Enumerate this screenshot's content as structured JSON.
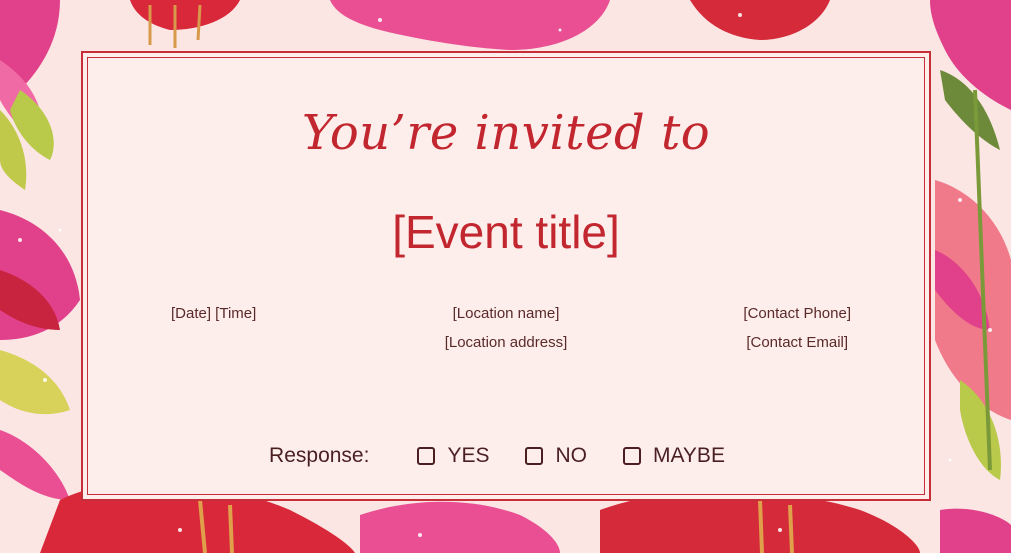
{
  "invitation": {
    "heading": "You’re invited to",
    "event_title": "[Event title]",
    "date_time": "[Date] [Time]",
    "location_name": "[Location name]",
    "location_address": "[Location address]",
    "contact_phone": "[Contact Phone]",
    "contact_email": "[Contact Email]"
  },
  "response": {
    "label": "Response:",
    "options": [
      "YES",
      "NO",
      "MAYBE"
    ]
  },
  "colors": {
    "accent": "#c2262f",
    "background": "#fbe6e3",
    "card": "#fdeeeb"
  }
}
